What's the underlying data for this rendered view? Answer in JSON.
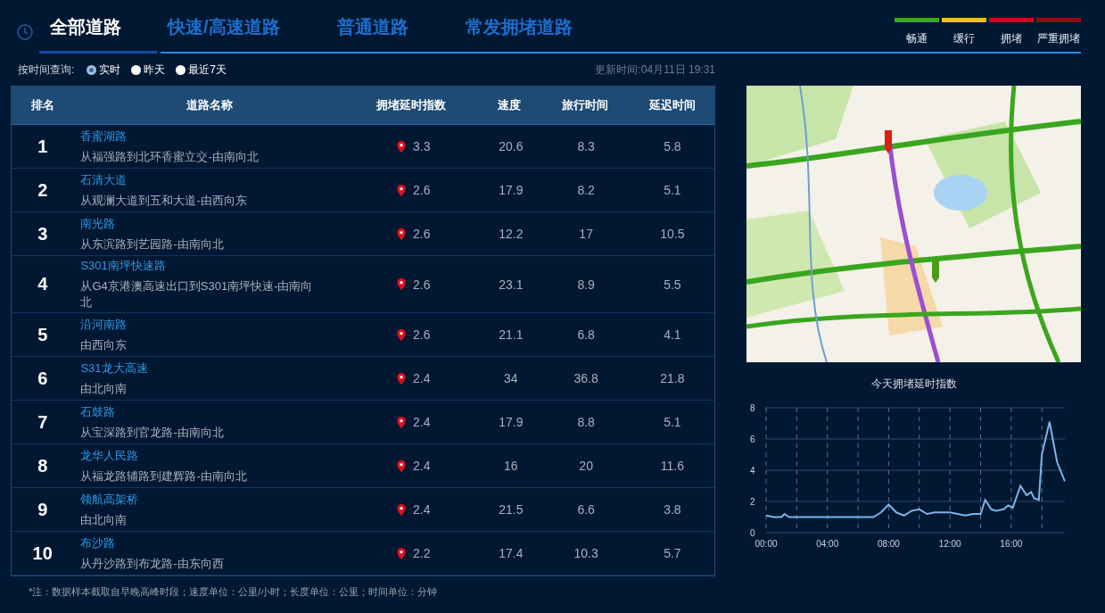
{
  "tabs": [
    {
      "label": "全部道路",
      "selected": true
    },
    {
      "label": "快速/高速道路",
      "selected": false
    },
    {
      "label": "普通道路",
      "selected": false
    },
    {
      "label": "常发拥堵道路",
      "selected": false
    }
  ],
  "legend": [
    {
      "label": "畅通",
      "color": "#3aa61e"
    },
    {
      "label": "缓行",
      "color": "#f2c01d"
    },
    {
      "label": "拥堵",
      "color": "#d9001b"
    },
    {
      "label": "严重拥堵",
      "color": "#8b0f0f"
    }
  ],
  "time_filter": {
    "label": "按时间查询:",
    "options": [
      {
        "label": "实时",
        "selected": true
      },
      {
        "label": "昨天",
        "selected": false
      },
      {
        "label": "最近7天",
        "selected": false
      }
    ]
  },
  "update_time": "更新时间:04月11日 19:31",
  "table": {
    "columns": [
      "排名",
      "道路名称",
      "拥堵延时指数",
      "速度",
      "旅行时间",
      "延迟时间"
    ],
    "rows": [
      {
        "rank": "1",
        "road": "香蜜湖路",
        "section": "从福强路到北环香蜜立交-由南向北",
        "index": "3.3",
        "speed": "20.6",
        "travel_time": "8.3",
        "delay": "5.8"
      },
      {
        "rank": "2",
        "road": "石清大道",
        "section": "从观澜大道到五和大道-由西向东",
        "index": "2.6",
        "speed": "17.9",
        "travel_time": "8.2",
        "delay": "5.1"
      },
      {
        "rank": "3",
        "road": "南光路",
        "section": "从东滨路到艺园路-由南向北",
        "index": "2.6",
        "speed": "12.2",
        "travel_time": "17",
        "delay": "10.5"
      },
      {
        "rank": "4",
        "road": "S301南坪快速路",
        "section": "从G4京港澳高速出口到S301南坪快速-由南向北",
        "index": "2.6",
        "speed": "23.1",
        "travel_time": "8.9",
        "delay": "5.5"
      },
      {
        "rank": "5",
        "road": "沿河南路",
        "section": "由西向东",
        "index": "2.6",
        "speed": "21.1",
        "travel_time": "6.8",
        "delay": "4.1"
      },
      {
        "rank": "6",
        "road": "S31龙大高速",
        "section": "由北向南",
        "index": "2.4",
        "speed": "34",
        "travel_time": "36.8",
        "delay": "21.8"
      },
      {
        "rank": "7",
        "road": "石鼓路",
        "section": "从宝深路到官龙路-由南向北",
        "index": "2.4",
        "speed": "17.9",
        "travel_time": "8.8",
        "delay": "5.1"
      },
      {
        "rank": "8",
        "road": "龙华人民路",
        "section": "从福龙路辅路到建辉路-由南向北",
        "index": "2.4",
        "speed": "16",
        "travel_time": "20",
        "delay": "11.6"
      },
      {
        "rank": "9",
        "road": "领航高架桥",
        "section": "由北向南",
        "index": "2.4",
        "speed": "21.5",
        "travel_time": "6.6",
        "delay": "3.8"
      },
      {
        "rank": "10",
        "road": "布沙路",
        "section": "从丹沙路到布龙路-由东向西",
        "index": "2.2",
        "speed": "17.4",
        "travel_time": "10.3",
        "delay": "5.7"
      }
    ]
  },
  "note": "*注：数据样本截取自早晚高峰时段；速度单位：公里/小时；长度单位：公里；时间单位：分钟",
  "chart_data": {
    "type": "line",
    "title": "今天拥堵延时指数",
    "xlim": [
      0,
      19.5
    ],
    "ylim": [
      0,
      8
    ],
    "xticks": [
      {
        "value": 0,
        "label": "00:00"
      },
      {
        "value": 4,
        "label": "04:00"
      },
      {
        "value": 8,
        "label": "08:00"
      },
      {
        "value": 12,
        "label": "12:00"
      },
      {
        "value": 16,
        "label": "16:00"
      }
    ],
    "yticks": [
      0,
      2,
      4,
      6,
      8
    ],
    "x": [
      0,
      0.5,
      1,
      1.2,
      1.5,
      2,
      3,
      4,
      5,
      6,
      7,
      7.5,
      8,
      8.5,
      9,
      9.5,
      10,
      10.5,
      11,
      11.5,
      12,
      12.5,
      13,
      13.5,
      14,
      14.3,
      14.7,
      15,
      15.5,
      15.8,
      16.1,
      16.6,
      17,
      17.3,
      17.5,
      17.8,
      18,
      18.5,
      19,
      19.5
    ],
    "grid": true,
    "series": [
      {
        "color": "#7fb3e8",
        "values": [
          1.1,
          1.0,
          1.0,
          1.2,
          1.0,
          1.0,
          1.0,
          1.0,
          1.0,
          1.0,
          1.0,
          1.3,
          1.8,
          1.3,
          1.1,
          1.4,
          1.5,
          1.2,
          1.3,
          1.3,
          1.3,
          1.2,
          1.1,
          1.2,
          1.2,
          2.1,
          1.5,
          1.4,
          1.5,
          1.75,
          1.6,
          3.0,
          2.4,
          2.6,
          2.2,
          2.1,
          5.0,
          7.1,
          4.5,
          3.3
        ]
      }
    ]
  }
}
